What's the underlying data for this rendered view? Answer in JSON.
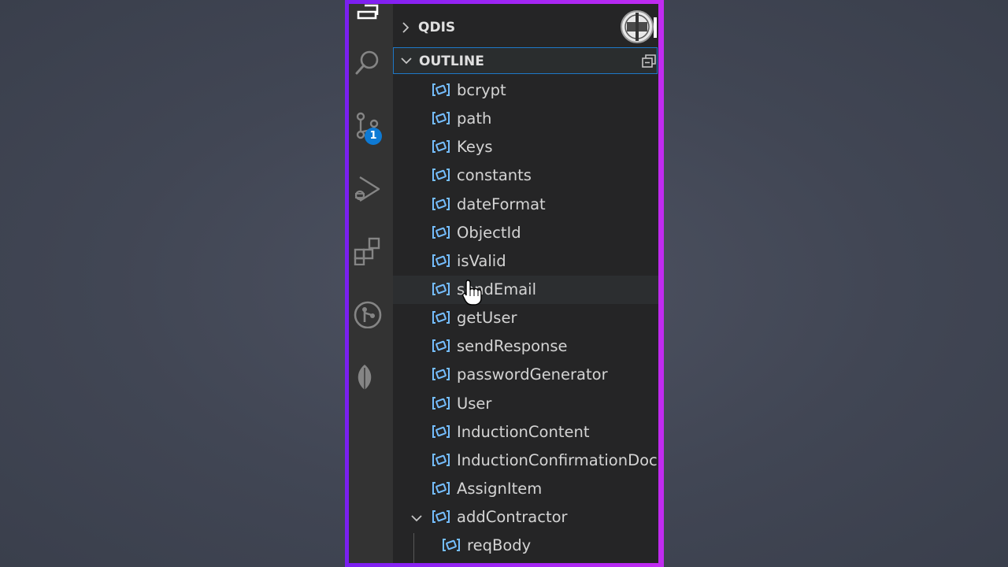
{
  "colors": {
    "frame": "#9f25f5",
    "activity_bar": "#333333",
    "sidebar": "#252526",
    "symbol_icon": "#75beff",
    "badge": "#0e7ad4",
    "focus_border": "#1e78c8"
  },
  "activity_bar": {
    "items": [
      {
        "name": "explorer",
        "icon": "files-icon"
      },
      {
        "name": "search",
        "icon": "search-icon"
      },
      {
        "name": "source-control",
        "icon": "source-control-icon",
        "badge": "1"
      },
      {
        "name": "run-debug",
        "icon": "run-debug-icon"
      },
      {
        "name": "extensions",
        "icon": "extensions-icon"
      },
      {
        "name": "git-graph",
        "icon": "git-graph-icon"
      },
      {
        "name": "mongodb",
        "icon": "leaf-icon"
      }
    ]
  },
  "sidebar": {
    "sections": [
      {
        "title": "QDIS",
        "expanded": false
      },
      {
        "title": "OUTLINE",
        "expanded": true,
        "action": "collapse-all-icon"
      }
    ],
    "outline_items": [
      {
        "label": "bcrypt"
      },
      {
        "label": "path"
      },
      {
        "label": "Keys"
      },
      {
        "label": "constants"
      },
      {
        "label": "dateFormat"
      },
      {
        "label": "ObjectId"
      },
      {
        "label": "isValid"
      },
      {
        "label": "sendEmail",
        "hovered": true
      },
      {
        "label": "getUser"
      },
      {
        "label": "sendResponse"
      },
      {
        "label": "passwordGenerator"
      },
      {
        "label": "User"
      },
      {
        "label": "InductionContent"
      },
      {
        "label": "InductionConfirmationDoc"
      },
      {
        "label": "AssignItem"
      },
      {
        "label": "addContractor",
        "expanded": true
      },
      {
        "label": "reqBody",
        "child": true
      }
    ]
  }
}
